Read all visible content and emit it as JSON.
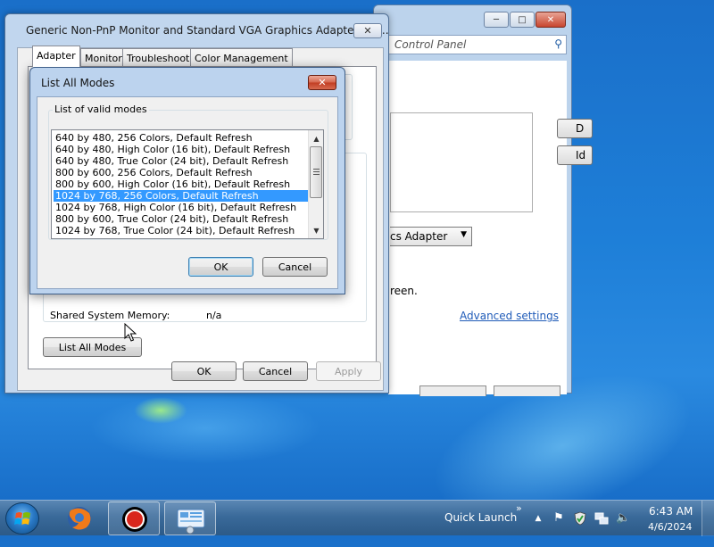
{
  "background_window": {
    "address_text": "Control Panel",
    "button_labels": [
      "D",
      "Id"
    ],
    "adapter_select": "cs Adapter",
    "text_fragment": "reen.",
    "advanced_settings_link": "Advanced settings"
  },
  "properties_dialog": {
    "title": "Generic Non-PnP Monitor and Standard VGA Graphics Adapter Pro...",
    "tabs": [
      "Adapter",
      "Monitor",
      "Troubleshoot",
      "Color Management"
    ],
    "active_tab": "Adapter",
    "shared_memory_label": "Shared System Memory:",
    "shared_memory_value": "n/a",
    "list_all_modes_button": "List All Modes",
    "ok": "OK",
    "cancel": "Cancel",
    "apply": "Apply"
  },
  "list_modes_dialog": {
    "title": "List All Modes",
    "group_label": "List of valid modes",
    "modes": [
      "640 by 480, 256 Colors, Default Refresh",
      "640 by 480, High Color (16 bit), Default Refresh",
      "640 by 480, True Color (24 bit), Default Refresh",
      "800 by 600, 256 Colors, Default Refresh",
      "800 by 600, High Color (16 bit), Default Refresh",
      "1024 by 768, 256 Colors, Default Refresh",
      "1024 by 768, High Color (16 bit), Default Refresh",
      "800 by 600, True Color (24 bit), Default Refresh",
      "1024 by 768, True Color (24 bit), Default Refresh"
    ],
    "selected_index": 5,
    "ok": "OK",
    "cancel": "Cancel"
  },
  "taskbar": {
    "quick_launch": "Quick Launch",
    "time": "6:43 AM",
    "date": "4/6/2024",
    "chevron": "»"
  },
  "icons": {
    "close": "✕",
    "minimize": "─",
    "maximize": "□",
    "search": "⚲",
    "dropdown": "▼",
    "scroll_up": "▲",
    "scroll_down": "▼",
    "tray_up": "▲",
    "tray_flag": "⚑",
    "tray_volume": "🔈"
  }
}
